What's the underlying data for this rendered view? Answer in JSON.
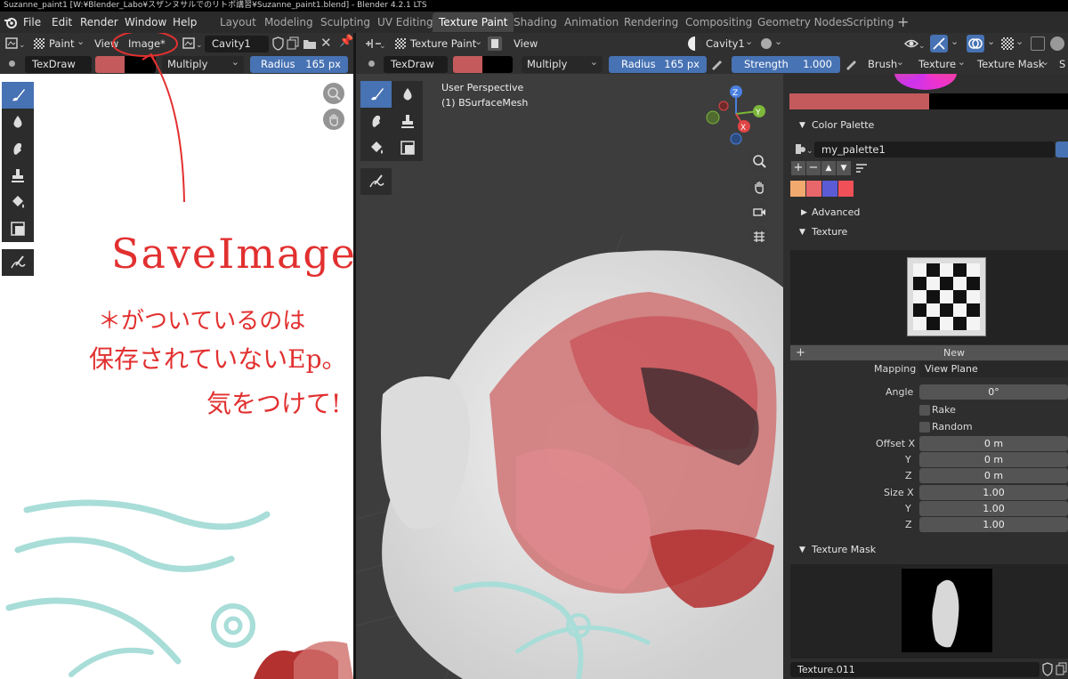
{
  "window_title": "Suzanne_paint1 [W:¥Blender_Labo¥スザンヌサルでのリトポ講習¥Suzanne_paint1.blend] - Blender 4.2.1 LTS",
  "menu": [
    "File",
    "Edit",
    "Render",
    "Window",
    "Help"
  ],
  "workspaces": [
    "Layout",
    "Modeling",
    "Sculpting",
    "UV Editing",
    "Texture Paint",
    "Shading",
    "Animation",
    "Rendering",
    "Compositing",
    "Geometry Nodes",
    "Scripting"
  ],
  "workspace_active": "Texture Paint",
  "image_editor": {
    "header": {
      "mode": "Paint",
      "view": "View",
      "image": "Image*",
      "image_name": "Cavity1"
    },
    "toolbar": {
      "brush": "TexDraw",
      "blend": "Multiply",
      "radius_label": "Radius",
      "radius_value": "165 px"
    },
    "annotation": {
      "line1": "SaveImages!!",
      "line2": "＊がついているのは",
      "line3": "保存されていないEp。",
      "line4": "気をつけて!"
    }
  },
  "viewport": {
    "header": {
      "mode": "Texture Paint",
      "view": "View",
      "shading_obj": "Cavity1"
    },
    "toolbar": {
      "brush": "TexDraw",
      "blend": "Multiply",
      "radius_label": "Radius",
      "radius_value": "165 px",
      "strength_label": "Strength",
      "strength_value": "1.000",
      "brush_menu": "Brush",
      "texture_menu": "Texture",
      "texture_mask_menu": "Texture Mask",
      "more": "S"
    },
    "overlay": {
      "perspective": "User Perspective",
      "object": "(1) BSurfaceMesh"
    },
    "gizmo": {
      "x": "X",
      "y": "Y",
      "z": "Z"
    }
  },
  "properties": {
    "color_palette": {
      "title": "Color Palette",
      "name": "my_palette1",
      "swatches": [
        "#f2a96e",
        "#e8676a",
        "#5b5bd6",
        "#f05058"
      ]
    },
    "advanced": "Advanced",
    "texture": {
      "title": "Texture",
      "new_button": "New"
    },
    "mapping": {
      "label": "Mapping",
      "value": "View Plane"
    },
    "angle": {
      "label": "Angle",
      "value": "0°"
    },
    "rake": "Rake",
    "random": "Random",
    "offset": {
      "x_label": "Offset X",
      "y_label": "Y",
      "z_label": "Z",
      "x": "0 m",
      "y": "0 m",
      "z": "0 m"
    },
    "size": {
      "x_label": "Size X",
      "y_label": "Y",
      "z_label": "Z",
      "x": "1.00",
      "y": "1.00",
      "z": "1.00"
    },
    "texture_mask": {
      "title": "Texture Mask",
      "texture_name": "Texture.011"
    }
  },
  "colors": {
    "accent": "#4772b3",
    "brush_color": "#c45a5c",
    "annotation": "#e23030"
  }
}
